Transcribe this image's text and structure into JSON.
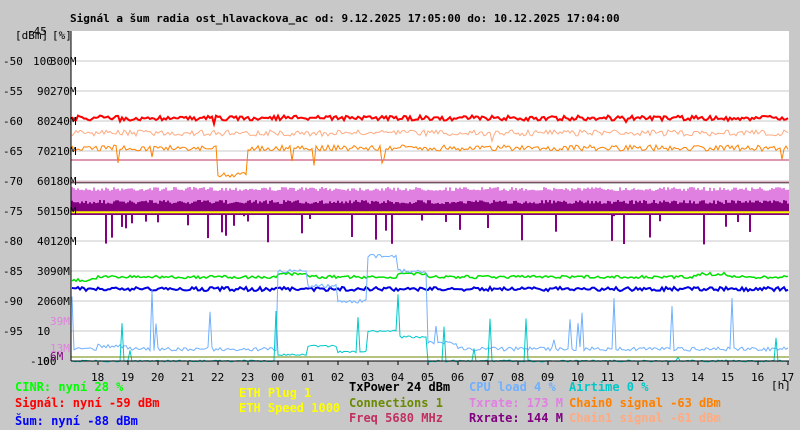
{
  "title": "Signál a šum radia ost_hlavackova_ac od: 9.12.2025 17:05:00 do: 10.12.2025 17:04:00",
  "legend": {
    "cinr": "CINR: nyní 28 %",
    "signal": "Signál: nyní -59 dBm",
    "noise": "Šum: nyní -88 dBm",
    "eth_plug": "ETH Plug 1",
    "eth_speed": "ETH Speed 1000",
    "txpower": "TxPower 24 dBm",
    "connections": "Connections 1",
    "freq": "Freq 5680 MHz",
    "cpu": "CPU load 4 %",
    "txrate": "Txrate: 173 M",
    "rxrate": "Rxrate: 144 M",
    "airtime": "Airtime 0 %",
    "chain0": "Chain0 signal -63 dBm",
    "chain1": "Chain1 signal -61 dBm"
  },
  "colors": {
    "signal": "#ff0000",
    "chain1": "#ffaa80",
    "chain0": "#ff8000",
    "cinr": "#00e000",
    "noise": "#0000e0",
    "txrate": "#e080e0",
    "rxrate": "#800080",
    "cpu": "#70b0ff",
    "airtime": "#00c8c8",
    "eth": "#ffff00",
    "connections": "#6a8a00",
    "freq": "#c03060",
    "txpower": "#000000"
  },
  "chart_data": {
    "type": "line",
    "title": "Signál a šum radia ost_hlavackova_ac od: 9.12.2025 17:05:00 do: 10.12.2025 17:04:00",
    "xlabel": "[h]",
    "x_ticks": [
      "18",
      "19",
      "20",
      "21",
      "22",
      "23",
      "00",
      "01",
      "02",
      "03",
      "04",
      "05",
      "06",
      "07",
      "08",
      "09",
      "10",
      "11",
      "12",
      "13",
      "14",
      "15",
      "16",
      "17"
    ],
    "y_dbm_label": "[dBm]",
    "y_pct_label": "[%]",
    "y_dbm_ticks": [
      "-45",
      "-50",
      "-55",
      "-60",
      "-65",
      "-70",
      "-75",
      "-80",
      "-85",
      "-90",
      "-95",
      "-100"
    ],
    "y_pct_ticks": [
      "100",
      "90",
      "80",
      "70",
      "60",
      "50",
      "40",
      "30",
      "20",
      "10",
      "0"
    ],
    "y_rate_ticks": [
      "300M",
      "270M",
      "240M",
      "210M",
      "180M",
      "150M",
      "120M",
      "90M",
      "60M"
    ],
    "extra_rate_labels": {
      "txrate_min": "39M",
      "txrate_low": "13M",
      "rxrate_low": "6M"
    },
    "ylim_dbm": [
      -100,
      -45
    ],
    "ylim_pct": [
      0,
      100
    ],
    "ylim_rate": [
      0,
      300
    ],
    "series": [
      {
        "name": "Signal (dBm)",
        "key": "signal",
        "axis": "dbm",
        "values": [
          -59.5,
          -59.5,
          -59.6,
          -59.5,
          -59.5,
          -59.6,
          -59.5,
          -59.5,
          -59.4,
          -59.5,
          -59.6,
          -59.5,
          -59.5,
          -59.5,
          -59.5,
          -59.6,
          -59.5,
          -59.5,
          -59.5,
          -59.5,
          -59.5,
          -59.5,
          -59.6,
          -59.5
        ]
      },
      {
        "name": "Chain1 (dBm)",
        "key": "chain1",
        "axis": "dbm",
        "values": [
          -62,
          -62,
          -62,
          -62,
          -62,
          -62,
          -62,
          -62,
          -62,
          -62,
          -62,
          -62,
          -62,
          -62,
          -62,
          -62,
          -62,
          -62,
          -62,
          -62,
          -62,
          -62,
          -62,
          -62
        ]
      },
      {
        "name": "Chain0 (dBm)",
        "key": "chain0",
        "axis": "dbm",
        "values": [
          -64.5,
          -64.5,
          -64.5,
          -64.5,
          -64.5,
          -69,
          -64.5,
          -64.5,
          -64.5,
          -64.5,
          -64.5,
          -64.5,
          -64.5,
          -64.5,
          -64.5,
          -64.5,
          -64.5,
          -64.5,
          -64.5,
          -64.5,
          -64.5,
          -64.5,
          -64.5,
          -64.5
        ]
      },
      {
        "name": "Txrate (M)",
        "key": "txrate",
        "axis": "rate",
        "values": [
          173,
          173,
          173,
          173,
          173,
          173,
          173,
          173,
          173,
          173,
          173,
          173,
          173,
          173,
          173,
          173,
          173,
          173,
          173,
          173,
          173,
          173,
          173,
          173
        ]
      },
      {
        "name": "Rxrate (M)",
        "key": "rxrate",
        "axis": "rate",
        "values": [
          150,
          148,
          150,
          150,
          148,
          150,
          150,
          148,
          146,
          150,
          146,
          150,
          150,
          150,
          150,
          150,
          150,
          148,
          150,
          150,
          150,
          150,
          150,
          144
        ]
      },
      {
        "name": "CINR (%)",
        "key": "cinr",
        "axis": "pct",
        "values": [
          27,
          28,
          28,
          28,
          28,
          28,
          28,
          29,
          28,
          28,
          28,
          29,
          28,
          28,
          28,
          28,
          28,
          28,
          28,
          28,
          28,
          29,
          28,
          28
        ]
      },
      {
        "name": "Noise (dBm)",
        "key": "noise",
        "axis": "dbm",
        "values": [
          -88,
          -88,
          -88,
          -88,
          -88,
          -88,
          -88,
          -88,
          -88,
          -88,
          -88,
          -88,
          -88,
          -88,
          -88,
          -88,
          -88,
          -88,
          -88,
          -88,
          -88,
          -88,
          -88,
          -88
        ]
      },
      {
        "name": "CPU load (%)",
        "key": "cpu",
        "axis": "pct",
        "values": [
          4,
          5,
          4,
          4,
          4,
          4,
          4,
          30,
          25,
          20,
          35,
          30,
          6,
          4,
          4,
          4,
          4,
          4,
          4,
          4,
          4,
          4,
          4,
          4
        ]
      },
      {
        "name": "Airtime (%)",
        "key": "airtime",
        "axis": "pct",
        "values": [
          0,
          0,
          0,
          0,
          0,
          0,
          0,
          2,
          5,
          3,
          10,
          8,
          0,
          0,
          0,
          0,
          0,
          0,
          0,
          0,
          0,
          0,
          0,
          0
        ]
      },
      {
        "name": "Freq",
        "key": "freq",
        "axis": "dbm",
        "values": [
          -66.5
        ]
      },
      {
        "name": "TxPower",
        "key": "txpower",
        "axis": "dbm",
        "values": [
          -70.3
        ]
      },
      {
        "name": "ETH speed",
        "key": "eth",
        "axis": "dbm",
        "values": [
          -75.2
        ]
      },
      {
        "name": "Connections",
        "key": "connections",
        "axis": "pct",
        "values": [
          1
        ]
      }
    ]
  }
}
